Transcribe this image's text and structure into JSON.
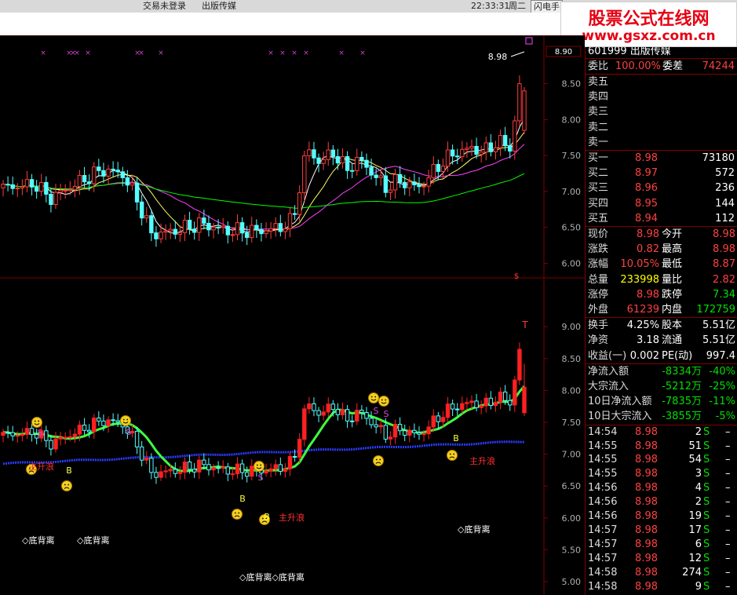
{
  "topbar": {
    "trade_status": "交易未登录",
    "stock_name": "出版传媒",
    "time": "22:33:31",
    "weekday": "周二",
    "menu_flash": "闪电手"
  },
  "watermark": {
    "line1": "股票公式在线网",
    "line2": "www.gsxz.com.cn"
  },
  "stock_header": "601999 出版传媒",
  "chart_data": [
    {
      "type": "candlestick",
      "panel": "main",
      "y_ticks": [
        "8.50",
        "8.00",
        "7.50",
        "7.00",
        "6.50",
        "6.00"
      ],
      "ylim": [
        5.95,
        8.9
      ],
      "price_tag": "8.90",
      "last_close_label": "8.98",
      "marker_text": "$",
      "series": [
        {
          "name": "MA5",
          "color": "#ffffff"
        },
        {
          "name": "MA10",
          "color": "#ffff66"
        },
        {
          "name": "MA20",
          "color": "#ff40ff"
        },
        {
          "name": "MA60",
          "color": "#00ff00"
        }
      ]
    },
    {
      "type": "candlestick",
      "panel": "indicator",
      "y_ticks": [
        "9.00",
        "8.50",
        "8.00",
        "7.50",
        "7.00",
        "6.50",
        "6.00",
        "5.50",
        "5.00"
      ],
      "ylim": [
        4.95,
        9.2
      ],
      "top_marker": "T",
      "labels": {
        "divergence": [
          "◇底背离",
          "◇底背离",
          "◇底背离◇底背离",
          "◇底背离"
        ],
        "main_wave": [
          "主升浪",
          "主升浪",
          "主升浪"
        ],
        "buy": "B",
        "sell": "S"
      }
    }
  ],
  "quote": {
    "weibi_label": "委比",
    "weibi_value": "100.00%",
    "weicha_label": "委差",
    "weicha_value": "74244",
    "sell": [
      {
        "label": "卖五",
        "price": "",
        "vol": ""
      },
      {
        "label": "卖四",
        "price": "",
        "vol": ""
      },
      {
        "label": "卖三",
        "price": "",
        "vol": ""
      },
      {
        "label": "卖二",
        "price": "",
        "vol": ""
      },
      {
        "label": "卖一",
        "price": "",
        "vol": ""
      }
    ],
    "buy": [
      {
        "label": "买一",
        "price": "8.98",
        "vol": "73180"
      },
      {
        "label": "买二",
        "price": "8.97",
        "vol": "572"
      },
      {
        "label": "买三",
        "price": "8.96",
        "vol": "236"
      },
      {
        "label": "买四",
        "price": "8.95",
        "vol": "144"
      },
      {
        "label": "买五",
        "price": "8.94",
        "vol": "112"
      }
    ],
    "stats": [
      {
        "l1": "现价",
        "v1": "8.98",
        "c1": "red",
        "l2": "今开",
        "v2": "8.98",
        "c2": "red"
      },
      {
        "l1": "涨跌",
        "v1": "0.82",
        "c1": "red",
        "l2": "最高",
        "v2": "8.98",
        "c2": "red"
      },
      {
        "l1": "涨幅",
        "v1": "10.05%",
        "c1": "red",
        "l2": "最低",
        "v2": "8.87",
        "c2": "red"
      },
      {
        "l1": "总量",
        "v1": "233998",
        "c1": "yel",
        "l2": "量比",
        "v2": "2.82",
        "c2": "red"
      },
      {
        "l1": "涨停",
        "v1": "8.98",
        "c1": "red",
        "l2": "跌停",
        "v2": "7.34",
        "c2": "grn"
      },
      {
        "l1": "外盘",
        "v1": "61239",
        "c1": "red",
        "l2": "内盘",
        "v2": "172759",
        "c2": "grn"
      }
    ],
    "fund": [
      {
        "l1": "换手",
        "v1": "4.25%",
        "c1": "wht",
        "l2": "股本",
        "v2": "5.51亿",
        "c2": "wht"
      },
      {
        "l1": "净资",
        "v1": "3.18",
        "c1": "wht",
        "l2": "流通",
        "v2": "5.51亿",
        "c2": "wht"
      },
      {
        "l1": "收益(一)",
        "v1": "0.002",
        "c1": "wht",
        "l2": "PE(动)",
        "v2": "997.4",
        "c2": "wht"
      }
    ],
    "flow": [
      {
        "label": "净流入额",
        "value": "-8334万",
        "pct": "-40%"
      },
      {
        "label": "大宗流入",
        "value": "-5212万",
        "pct": "-25%"
      },
      {
        "label": "10日净流入额",
        "value": "-7835万",
        "pct": "-11%"
      },
      {
        "label": "10日大宗流入",
        "value": "-3855万",
        "pct": "-5%"
      }
    ],
    "ticks": [
      {
        "time": "14:54",
        "price": "8.98",
        "vol": "2",
        "side": "S"
      },
      {
        "time": "14:55",
        "price": "8.98",
        "vol": "51",
        "side": "S"
      },
      {
        "time": "14:55",
        "price": "8.98",
        "vol": "54",
        "side": "S"
      },
      {
        "time": "14:55",
        "price": "8.98",
        "vol": "3",
        "side": "S"
      },
      {
        "time": "14:56",
        "price": "8.98",
        "vol": "4",
        "side": "S"
      },
      {
        "time": "14:56",
        "price": "8.98",
        "vol": "2",
        "side": "S"
      },
      {
        "time": "14:56",
        "price": "8.98",
        "vol": "19",
        "side": "S"
      },
      {
        "time": "14:57",
        "price": "8.98",
        "vol": "17",
        "side": "S"
      },
      {
        "time": "14:57",
        "price": "8.98",
        "vol": "6",
        "side": "S"
      },
      {
        "time": "14:57",
        "price": "8.98",
        "vol": "12",
        "side": "S"
      },
      {
        "time": "14:58",
        "price": "8.98",
        "vol": "274",
        "side": "S"
      },
      {
        "time": "14:58",
        "price": "8.98",
        "vol": "9",
        "side": "S"
      }
    ],
    "tick_dash": "–"
  }
}
